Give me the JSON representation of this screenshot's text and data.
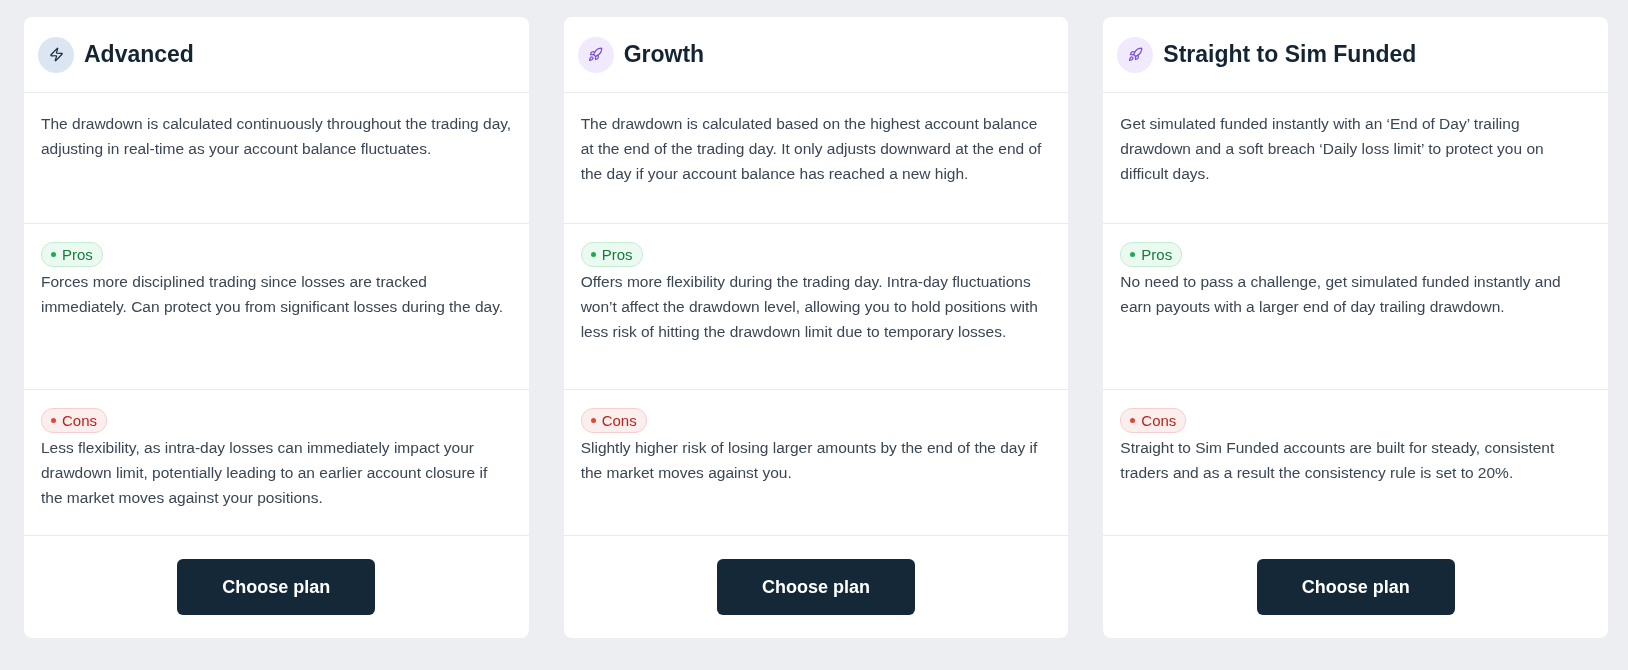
{
  "plans": [
    {
      "title": "Advanced",
      "kind": "bolt",
      "description": "The drawdown is calculated continuously throughout the trading day, adjusting in real-time as your account balance fluctuates.",
      "pros": {
        "label": "Pros",
        "text": "Forces more disciplined trading since losses are tracked immediately. Can protect you from significant losses during the day."
      },
      "cons": {
        "label": "Cons",
        "text": "Less flexibility, as intra-day losses can immediately impact your drawdown limit, potentially leading to an earlier account closure if the market moves against your positions."
      },
      "button": "Choose plan"
    },
    {
      "title": "Growth",
      "kind": "rocket",
      "description": "The drawdown is calculated based on the highest account balance at the end of the trading day. It only adjusts downward at the end of the day if your account balance has reached a new high.",
      "pros": {
        "label": "Pros",
        "text": "Offers more flexibility during the trading day. Intra-day fluctuations won’t affect the drawdown level, allowing you to hold positions with less risk of hitting the drawdown limit due to temporary losses."
      },
      "cons": {
        "label": "Cons",
        "text": "Slightly higher risk of losing larger amounts by the end of the day if the market moves against you."
      },
      "button": "Choose plan"
    },
    {
      "title": "Straight to Sim Funded",
      "kind": "rocket",
      "description": "Get simulated funded instantly with an ‘End of Day’ trailing drawdown and a soft breach ‘Daily loss limit’ to protect you on difficult days.",
      "pros": {
        "label": "Pros",
        "text": "No need to pass a challenge, get simulated funded instantly and earn payouts with a larger end of day trailing drawdown."
      },
      "cons": {
        "label": "Cons",
        "text": "Straight to Sim Funded accounts are built for steady, consistent traders and as a result the consistency rule is set to 20%."
      },
      "button": "Choose plan"
    }
  ]
}
